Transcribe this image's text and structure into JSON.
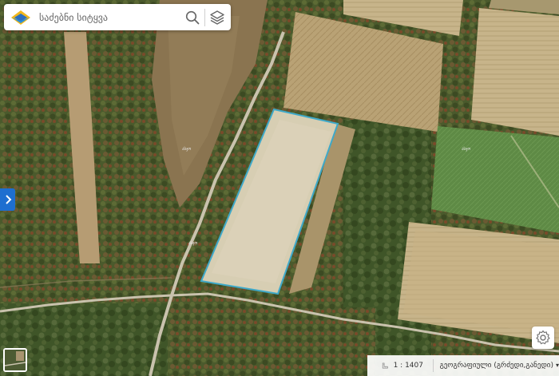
{
  "search": {
    "placeholder": "საძებნი სიტყვა"
  },
  "map": {
    "parcel_label_1": "ასჯო",
    "parcel_label_2": "ასჯო",
    "parcel_label_3": "ასჯო"
  },
  "status_bar": {
    "scale": "1 : 1407",
    "projection": "გეოგრაფიული (გრძედი,განედი)"
  },
  "colors": {
    "accent": "#1e6fd0",
    "parcel_outline": "#3fa9c9"
  },
  "icons": {
    "logo": "logo-icon",
    "search": "search-icon",
    "layers": "layers-icon",
    "panel_toggle": "chevron-right-icon",
    "settings": "gear-icon",
    "ruler": "ruler-icon",
    "dropdown": "chevron-down-icon"
  }
}
